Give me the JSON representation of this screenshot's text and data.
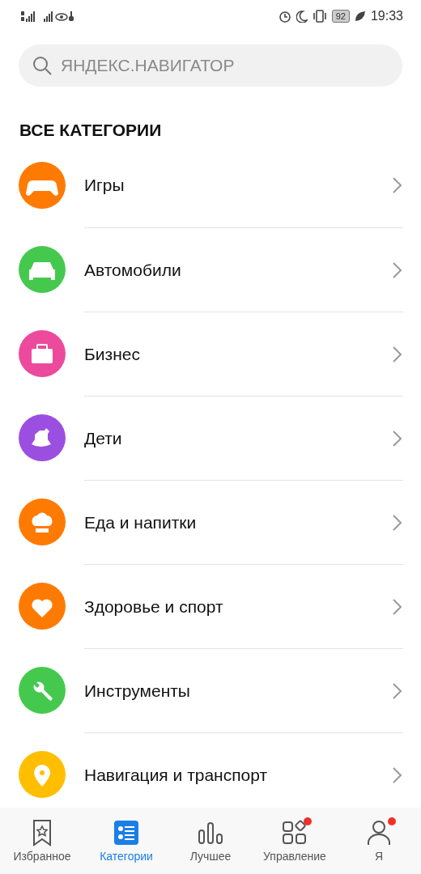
{
  "status_bar": {
    "battery": "92",
    "time": "19:33"
  },
  "search": {
    "placeholder": "ЯНДЕКС.НАВИГАТОР"
  },
  "section_title": "ВСЕ КАТЕГОРИИ",
  "categories": [
    {
      "label": "Игры",
      "kind": "games",
      "color": "#ff7a00"
    },
    {
      "label": "Автомобили",
      "kind": "cars",
      "color": "#44c94e"
    },
    {
      "label": "Бизнес",
      "kind": "business",
      "color": "#ec4a9c"
    },
    {
      "label": "Дети",
      "kind": "kids",
      "color": "#9b4fe0"
    },
    {
      "label": "Еда и напитки",
      "kind": "food",
      "color": "#ff7a00"
    },
    {
      "label": "Здоровье и спорт",
      "kind": "health",
      "color": "#ff7a00"
    },
    {
      "label": "Инструменты",
      "kind": "tools",
      "color": "#44c94e"
    },
    {
      "label": "Навигация и транспорт",
      "kind": "navigation",
      "color": "#ffbf00"
    }
  ],
  "tabs": [
    {
      "label": "Избранное",
      "kind": "favorites",
      "selected": false,
      "dot": false
    },
    {
      "label": "Категории",
      "kind": "categories",
      "selected": true,
      "dot": false
    },
    {
      "label": "Лучшее",
      "kind": "top",
      "selected": false,
      "dot": false
    },
    {
      "label": "Управление",
      "kind": "manage",
      "selected": false,
      "dot": true
    },
    {
      "label": "Я",
      "kind": "me",
      "selected": false,
      "dot": true
    }
  ]
}
